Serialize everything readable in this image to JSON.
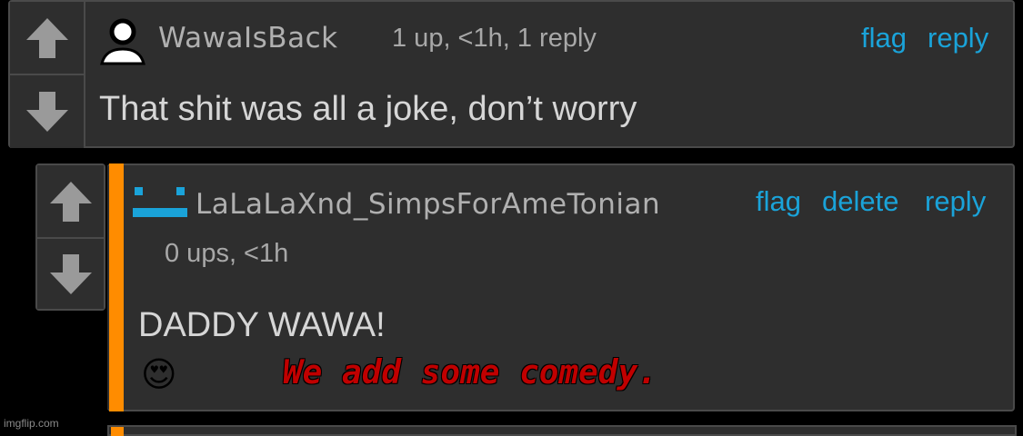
{
  "comment1": {
    "username": "WawaIsBack",
    "meta": "1 up, <1h, 1 reply",
    "actions": {
      "flag": "flag",
      "reply": "reply"
    },
    "body": "That shit was all a joke, don’t worry",
    "avatar_icon": "user-silhouette-icon"
  },
  "comment2": {
    "username": "LaLaLaXnd_SimpsForAmeTonian",
    "meta": "0 ups, <1h",
    "actions": {
      "flag": "flag",
      "delete": "delete",
      "reply": "reply"
    },
    "body": "DADDY WAWA!",
    "emoji": "😍",
    "avatar_icon": "face-emoticon-icon"
  },
  "overlay": {
    "text": "We add some comedy."
  },
  "watermark": "imgflip.com",
  "colors": {
    "link": "#1aa3d9",
    "accent_bar": "#ff8c00",
    "overlay": "#c00000",
    "panel": "#2e2e2e"
  }
}
